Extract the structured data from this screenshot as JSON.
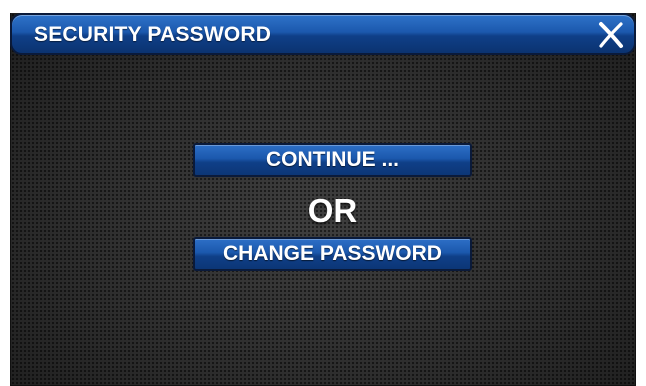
{
  "dialog": {
    "title": "SECURITY PASSWORD",
    "close_icon": "close-x-icon"
  },
  "actions": {
    "continue_label": "CONTINUE ...",
    "separator": "OR",
    "change_password_label": "CHANGE PASSWORD"
  },
  "colors": {
    "title_bar": "#1b58ad",
    "button": "#1b58ad",
    "background": "#2b2b2b",
    "text": "#ffffff"
  }
}
